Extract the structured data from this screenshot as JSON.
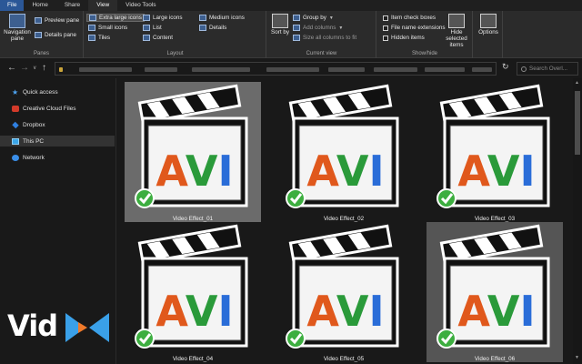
{
  "tabs": [
    {
      "label": "File",
      "active": false
    },
    {
      "label": "Home",
      "active": false
    },
    {
      "label": "Share",
      "active": false
    },
    {
      "label": "View",
      "active": true
    },
    {
      "label": "Video Tools",
      "active": false
    }
  ],
  "ribbon": {
    "panes": {
      "navigation_pane": "Navigation pane",
      "preview_pane": "Preview pane",
      "details_pane": "Details pane",
      "group_label": "Panes"
    },
    "layout": {
      "extra_large": "Extra large icons",
      "large": "Large icons",
      "medium": "Medium icons",
      "small": "Small icons",
      "list": "List",
      "details": "Details",
      "tiles": "Tiles",
      "content": "Content",
      "group_label": "Layout",
      "selected": "Extra large icons"
    },
    "current_view": {
      "sort_by": "Sort by",
      "group_by": "Group by",
      "add_columns": "Add columns",
      "size_all": "Size all columns to fit",
      "group_label": "Current view"
    },
    "show_hide": {
      "item_check_boxes": "Item check boxes",
      "file_name_extensions": "File name extensions",
      "hidden_items": "Hidden items",
      "hide_selected": "Hide selected items",
      "group_label": "Show/hide"
    },
    "options": "Options"
  },
  "search": {
    "placeholder": "Search Overl..."
  },
  "nav": [
    {
      "label": "Quick access",
      "icon": "star-icon"
    },
    {
      "label": "Creative Cloud Files",
      "icon": "creative-cloud-icon"
    },
    {
      "label": "Dropbox",
      "icon": "dropbox-icon"
    },
    {
      "label": "This PC",
      "icon": "computer-icon",
      "active": true
    },
    {
      "label": "Network",
      "icon": "network-icon"
    }
  ],
  "files": [
    {
      "name": "Video Effect_01",
      "badge": "AVI",
      "highlight": true
    },
    {
      "name": "Video Effect_02",
      "badge": "AVI"
    },
    {
      "name": "Video Effect_03",
      "badge": "AVI"
    },
    {
      "name": "Video Effect_04",
      "badge": "AVI"
    },
    {
      "name": "Video Effect_05",
      "badge": "AVI"
    },
    {
      "name": "Video Effect_06",
      "badge": "AVI",
      "highlight": true
    }
  ],
  "watermark": {
    "text": "Vid"
  },
  "colors": {
    "accent": "#2b5797",
    "avi_a": "#e0581c",
    "avi_v": "#2a9a3a",
    "avi_i": "#2a6dd8",
    "check": "#3cae3f"
  }
}
